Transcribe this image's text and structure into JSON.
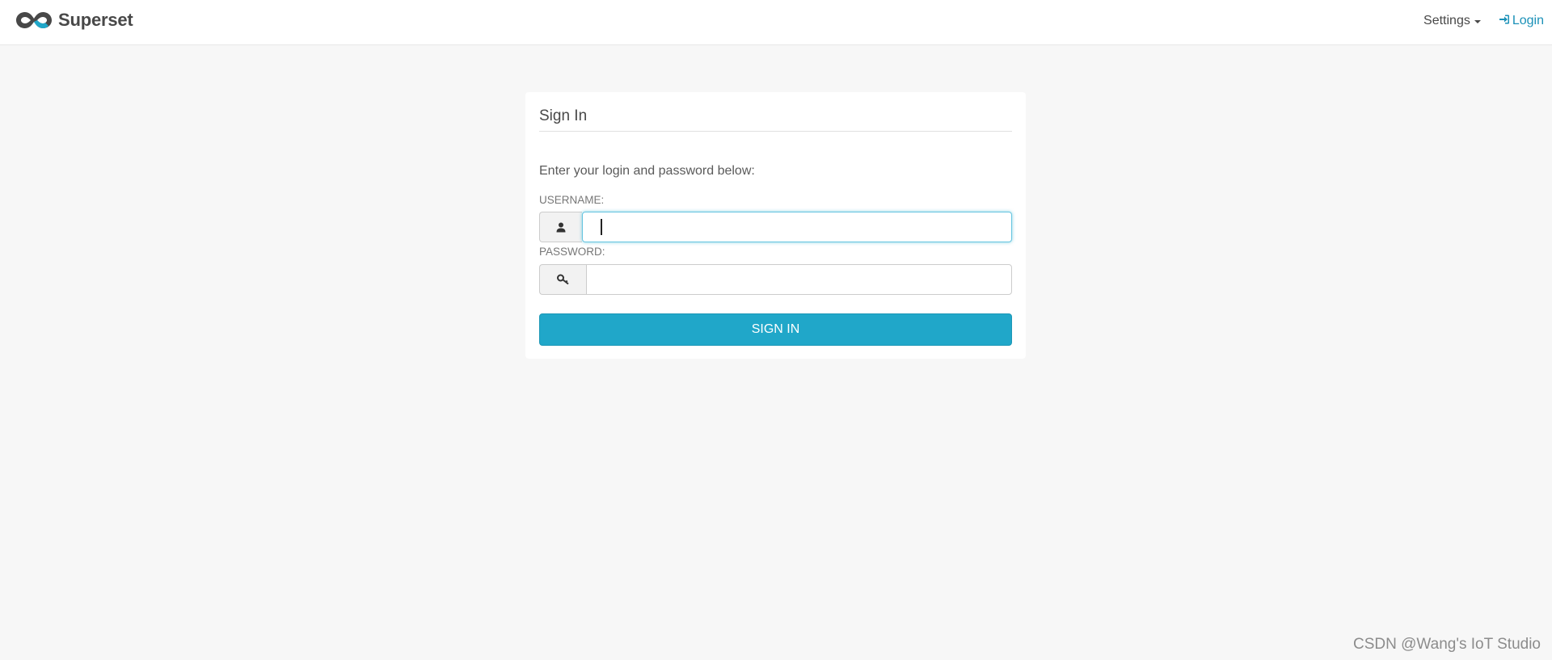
{
  "navbar": {
    "brand_icon": "superset-infinity-logo",
    "brand_name": "Superset",
    "settings_label": "Settings",
    "settings_icon": "caret-down-icon",
    "login_label": "Login",
    "login_icon": "sign-in-icon",
    "link_color": "#1b91b8"
  },
  "signin": {
    "title": "Sign In",
    "instructions": "Enter your login and password below:",
    "username_label": "USERNAME:",
    "username_icon": "user-icon",
    "username_value": "",
    "password_label": "PASSWORD:",
    "password_icon": "key-icon",
    "password_value": "",
    "button_label": "SIGN IN",
    "button_color": "#20a7c9"
  },
  "watermark": "CSDN @Wang's IoT Studio"
}
